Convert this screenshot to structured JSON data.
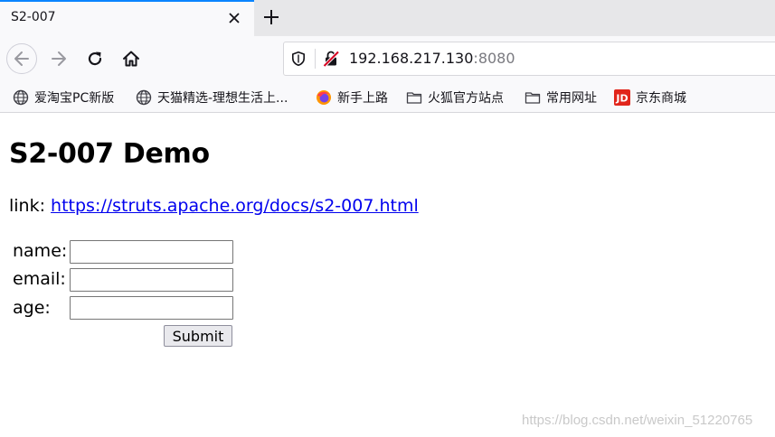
{
  "tab": {
    "title": "S2-007",
    "close_icon": "close-icon",
    "new_tab_icon": "plus-icon"
  },
  "nav": {
    "back_icon": "back-arrow-icon",
    "forward_icon": "forward-arrow-icon",
    "reload_icon": "reload-icon",
    "home_icon": "home-icon"
  },
  "urlbar": {
    "shield_icon": "tracking-shield-icon",
    "insecure_icon": "insecure-connection-icon",
    "host": "192.168.217.130",
    "port": ":8080"
  },
  "bookmarks": [
    {
      "label": "爱淘宝PC新版",
      "icon": "globe-icon"
    },
    {
      "label": "天猫精选-理想生活上...",
      "icon": "globe-icon"
    },
    {
      "label": "新手上路",
      "icon": "firefox-icon"
    },
    {
      "label": "火狐官方站点",
      "icon": "folder-icon"
    },
    {
      "label": "常用网址",
      "icon": "folder-icon"
    },
    {
      "label": "京东商城",
      "icon": "jd-icon"
    }
  ],
  "page": {
    "title": "S2-007 Demo",
    "link_prefix": "link: ",
    "link_text": "https://struts.apache.org/docs/s2-007.html",
    "form": {
      "name_label": "name:",
      "email_label": "email:",
      "age_label": "age:",
      "name_value": "",
      "email_value": "",
      "age_value": "",
      "submit_label": "Submit"
    }
  },
  "watermark": "https://blog.csdn.net/weixin_51220765",
  "colors": {
    "tab_accent": "#0a84ff",
    "link": "#0000ee",
    "insecure_red": "#d70022",
    "jd_red": "#e1251b"
  }
}
